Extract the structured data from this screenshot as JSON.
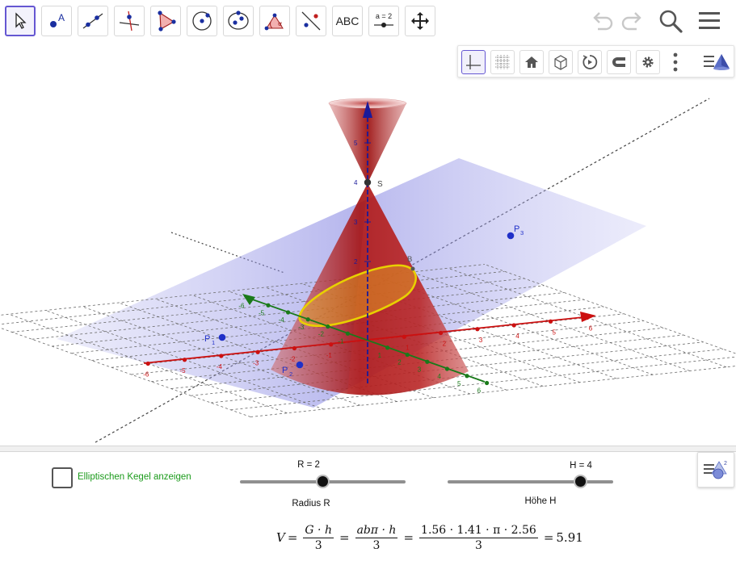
{
  "toolbar": {
    "text_tool_label": "ABC",
    "slider_tool_label": "a = 2"
  },
  "graphics": {
    "axis_ticks_x_pos": [
      "1",
      "2",
      "3",
      "4",
      "5",
      "6"
    ],
    "axis_ticks_x_neg": [
      "-6",
      "-5",
      "-4",
      "-3",
      "-2",
      "-1"
    ],
    "axis_ticks_y": [
      "-6",
      "-5",
      "-4",
      "-3",
      "-2",
      "-1",
      "1",
      "2",
      "3",
      "4",
      "5",
      "6"
    ],
    "axis_ticks_z": [
      "2",
      "3",
      "4",
      "5"
    ],
    "labels": {
      "apex": "S",
      "rim_point": "B",
      "p1": "P",
      "p1_sub": "1",
      "p2": "P",
      "p2_sub": "2",
      "p3": "P",
      "p3_sub": "3"
    },
    "colors": {
      "cone": "#b01818",
      "plane": "#7878e0",
      "x_axis": "#cc1010",
      "y_axis": "#1a7a1a",
      "z_axis": "#1a1a9a",
      "ellipse": "#e8d000",
      "accent": "#6557d2"
    }
  },
  "controls": {
    "checkbox_label": "Elliptischen Kegel anzeigen",
    "checkbox_checked": false,
    "slider_r": {
      "caption": "R = 2",
      "label": "Radius R",
      "value": 2,
      "fraction": 0.5
    },
    "slider_h": {
      "caption": "H = 4",
      "label": "Höhe H",
      "value": 4,
      "fraction": 0.8
    }
  },
  "formula": {
    "lhs": "V",
    "f1_num": "G · h",
    "f1_den": "3",
    "f2_num": "abπ · h",
    "f2_den": "3",
    "f3_num": "1.56 · 1.41 · π · 2.56",
    "f3_den": "3",
    "result": "5.91"
  }
}
